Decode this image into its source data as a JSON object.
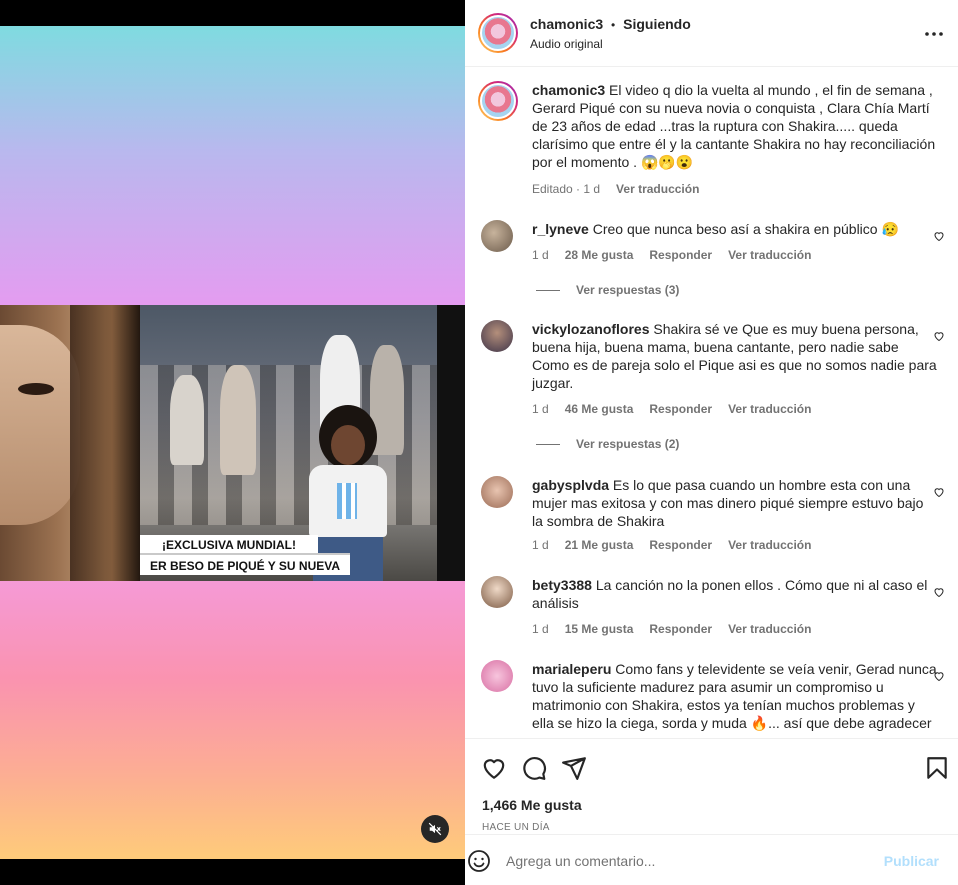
{
  "media": {
    "banner_line1": "¡EXCLUSIVA MUNDIAL!",
    "banner_line2": "ER BESO DE PIQUÉ Y SU NUEVA"
  },
  "header": {
    "username": "chamonic3",
    "separator": "•",
    "follow_status": "Siguiendo",
    "audio": "Audio original",
    "more": "···"
  },
  "caption": {
    "username": "chamonic3",
    "text": "El video q dio la vuelta al mundo , el fin de semana , Gerard Piqué con su nueva novia o conquista , Clara Chía Martí de 23 años de edad ...tras la ruptura con Shakira..... queda clarísimo que entre él y la cantante Shakira no hay reconciliación por el momento . 😱🫢😮",
    "edited": "Editado · 1 d",
    "translate": "Ver traducción"
  },
  "comments": [
    {
      "username": "r_lyneve",
      "text": "Creo que nunca beso así a shakira en público 😥",
      "time": "1 d",
      "likes": "28 Me gusta",
      "reply": "Responder",
      "translate": "Ver traducción",
      "replies": "Ver respuestas (3)"
    },
    {
      "username": "vickylozanoflores",
      "text": "Shakira sé ve Que es muy buena persona, buena hija, buena mama, buena cantante, pero nadie sabe Como es de pareja solo el Pique asi es que no somos nadie para juzgar.",
      "time": "1 d",
      "likes": "46 Me gusta",
      "reply": "Responder",
      "translate": "Ver traducción",
      "replies": "Ver respuestas (2)"
    },
    {
      "username": "gabysplvda",
      "text": "Es lo que pasa cuando un hombre esta con una mujer mas exitosa y con mas dinero piqué siempre estuvo bajo la sombra de Shakira",
      "time": "1 d",
      "likes": "21 Me gusta",
      "reply": "Responder",
      "translate": "Ver traducción"
    },
    {
      "username": "bety3388",
      "text": "La canción no la ponen ellos . Cómo que ni al caso el análisis",
      "time": "1 d",
      "likes": "15 Me gusta",
      "reply": "Responder",
      "translate": "Ver traducción"
    },
    {
      "username": "marialeperu",
      "text": "Como fans y televidente se veía venir, Gerad nunca tuvo la suficiente madurez para asumir un compromiso u matrimonio con Shakira, estos ya tenían muchos problemas y ella se hizo la ciega, sorda y muda 🔥... así que debe agradecer"
    }
  ],
  "footer": {
    "likes": "1,466 Me gusta",
    "time": "HACE UN DÍA",
    "comment_placeholder": "Agrega un comentario...",
    "post_label": "Publicar"
  },
  "colors": {
    "text": "#262626",
    "muted": "#737373",
    "post_disabled": "#b2dffc",
    "gradient_top": [
      "#7fdbe0",
      "#e49cf0"
    ],
    "gradient_bottom": [
      "#f59ad6",
      "#fecb7a"
    ]
  },
  "icons": [
    "like-icon",
    "comment-icon",
    "share-icon",
    "save-icon",
    "mute-icon",
    "emoji-icon",
    "more-options-icon",
    "small-heart-icon"
  ]
}
